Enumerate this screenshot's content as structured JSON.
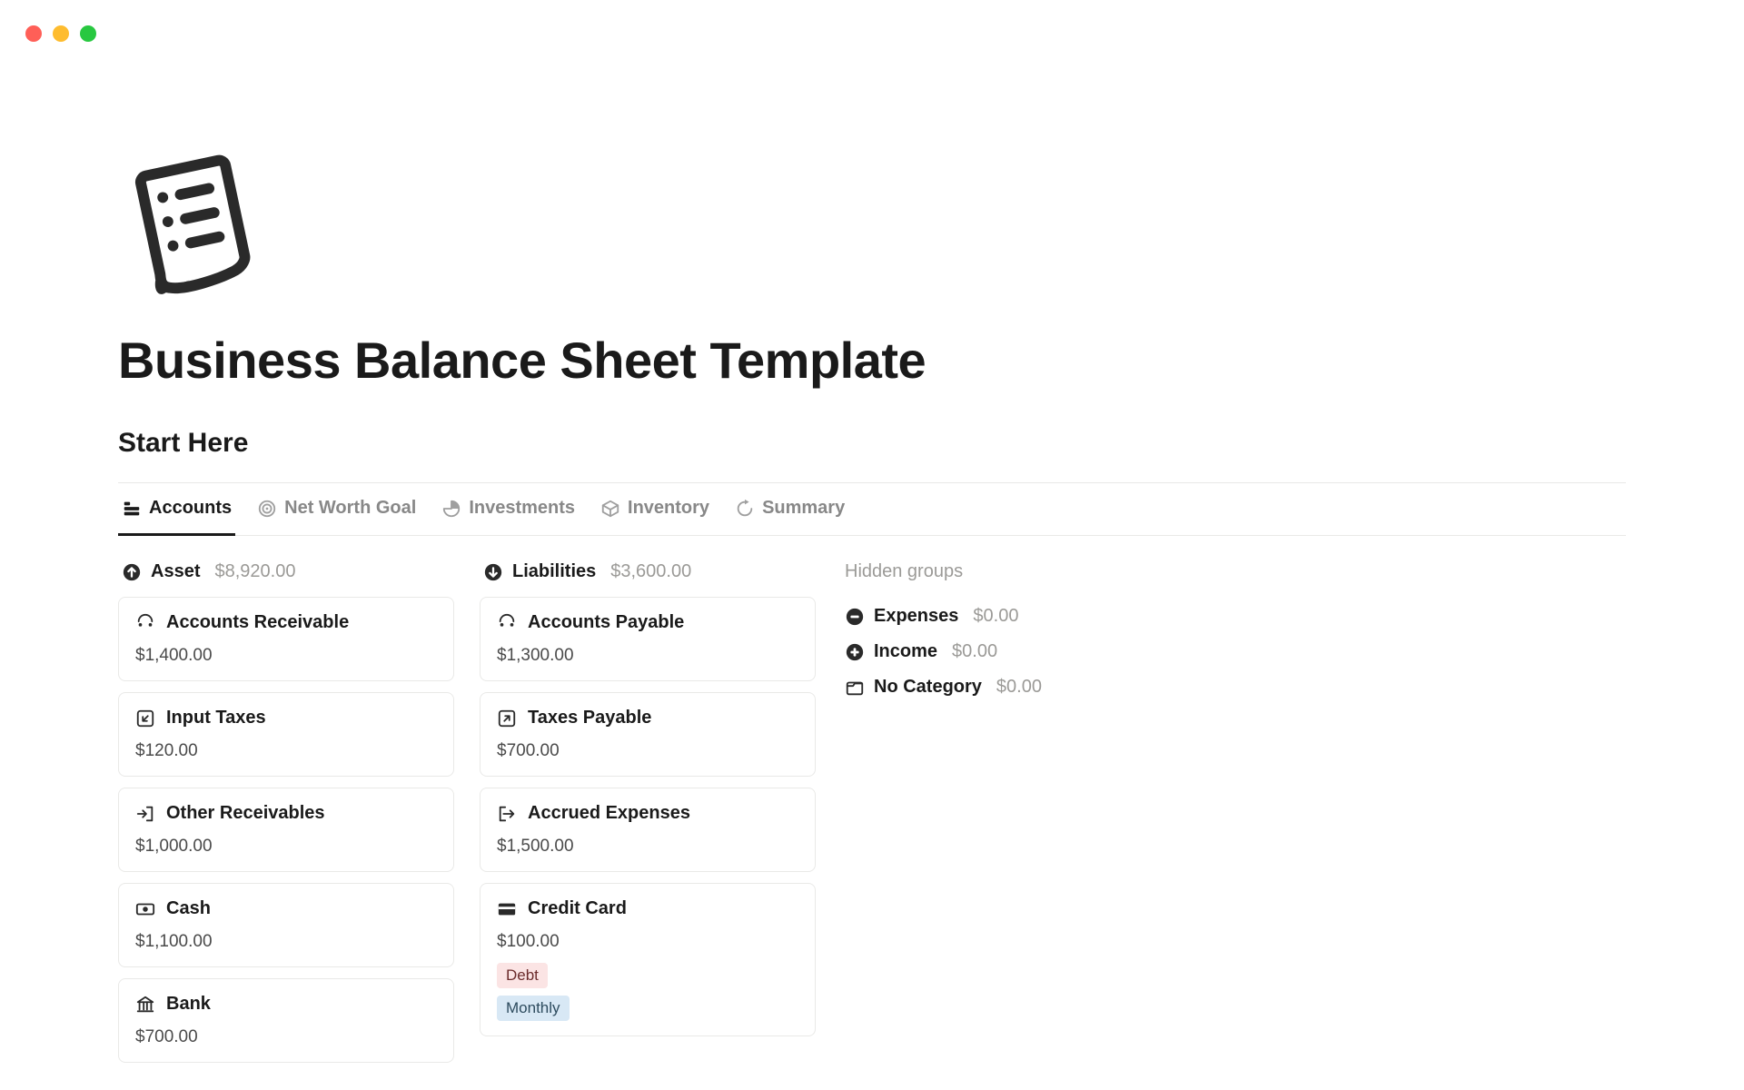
{
  "page": {
    "title": "Business Balance Sheet Template",
    "section": "Start Here"
  },
  "tabs": [
    {
      "label": "Accounts",
      "active": true,
      "icon": "list"
    },
    {
      "label": "Net Worth Goal",
      "active": false,
      "icon": "target"
    },
    {
      "label": "Investments",
      "active": false,
      "icon": "pie"
    },
    {
      "label": "Inventory",
      "active": false,
      "icon": "box"
    },
    {
      "label": "Summary",
      "active": false,
      "icon": "refresh"
    }
  ],
  "columns": [
    {
      "icon": "up",
      "title": "Asset",
      "amount": "$8,920.00",
      "cards": [
        {
          "icon": "receivable",
          "title": "Accounts Receivable",
          "amount": "$1,400.00"
        },
        {
          "icon": "arrow-in",
          "title": "Input Taxes",
          "amount": "$120.00"
        },
        {
          "icon": "log-in",
          "title": "Other Receivables",
          "amount": "$1,000.00"
        },
        {
          "icon": "cash",
          "title": "Cash",
          "amount": "$1,100.00"
        },
        {
          "icon": "bank",
          "title": "Bank",
          "amount": "$700.00"
        }
      ]
    },
    {
      "icon": "down",
      "title": "Liabilities",
      "amount": "$3,600.00",
      "cards": [
        {
          "icon": "receivable",
          "title": "Accounts Payable",
          "amount": "$1,300.00"
        },
        {
          "icon": "arrow-out",
          "title": "Taxes Payable",
          "amount": "$700.00"
        },
        {
          "icon": "log-out",
          "title": "Accrued Expenses",
          "amount": "$1,500.00"
        },
        {
          "icon": "credit-card",
          "title": "Credit Card",
          "amount": "$100.00",
          "tags": [
            {
              "text": "Debt",
              "class": "red"
            },
            {
              "text": "Monthly",
              "class": "blue"
            }
          ]
        }
      ]
    }
  ],
  "hidden": {
    "title": "Hidden groups",
    "items": [
      {
        "icon": "minus",
        "label": "Expenses",
        "amount": "$0.00"
      },
      {
        "icon": "plus",
        "label": "Income",
        "amount": "$0.00"
      },
      {
        "icon": "empty",
        "label": "No Category",
        "amount": "$0.00"
      }
    ]
  }
}
